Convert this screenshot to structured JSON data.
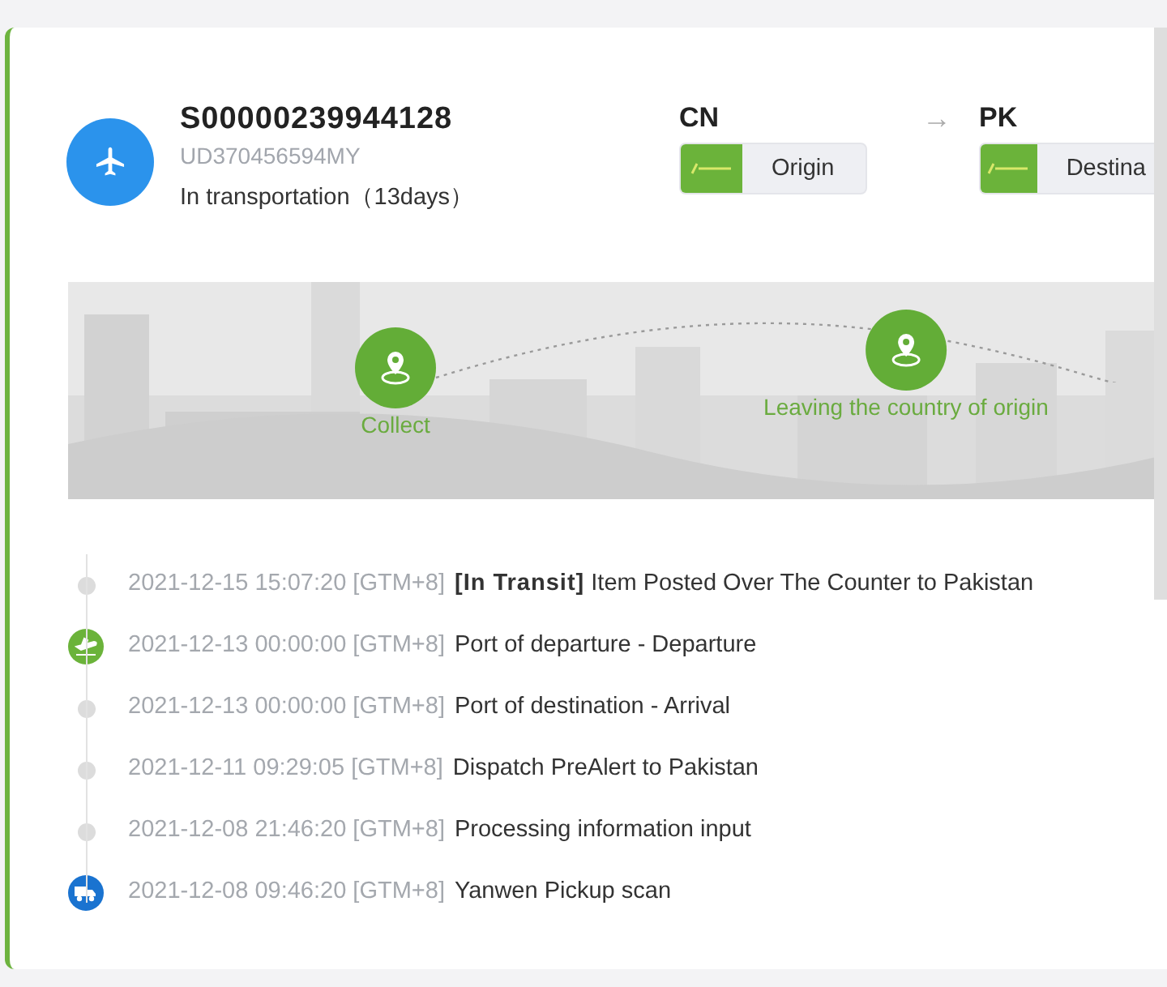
{
  "shipment": {
    "number": "S00000239944128",
    "tracking": "UD370456594MY",
    "status": "In transportation（13days）"
  },
  "route": {
    "from": {
      "code": "CN",
      "label": "Origin"
    },
    "arrow": "→",
    "to": {
      "code": "PK",
      "label": "Destina"
    }
  },
  "milestones": [
    {
      "label": "Collect"
    },
    {
      "label": "Leaving the country of origin"
    }
  ],
  "events": [
    {
      "kind": "dot",
      "time": "2021-12-15 15:07:20 [GTM+8]",
      "text": "**[In Transit]** Item Posted Over The Counter to Pakistan"
    },
    {
      "kind": "plane",
      "time": "2021-12-13 00:00:00 [GTM+8]",
      "text": "Port of departure - Departure"
    },
    {
      "kind": "dot",
      "time": "2021-12-13 00:00:00 [GTM+8]",
      "text": "Port of destination - Arrival"
    },
    {
      "kind": "dot",
      "time": "2021-12-11 09:29:05 [GTM+8]",
      "text": "Dispatch PreAlert to Pakistan"
    },
    {
      "kind": "dot",
      "time": "2021-12-08 21:46:20 [GTM+8]",
      "text": "Processing information input"
    },
    {
      "kind": "truck",
      "time": "2021-12-08 09:46:20 [GTM+8]",
      "text": "Yanwen Pickup scan"
    }
  ]
}
